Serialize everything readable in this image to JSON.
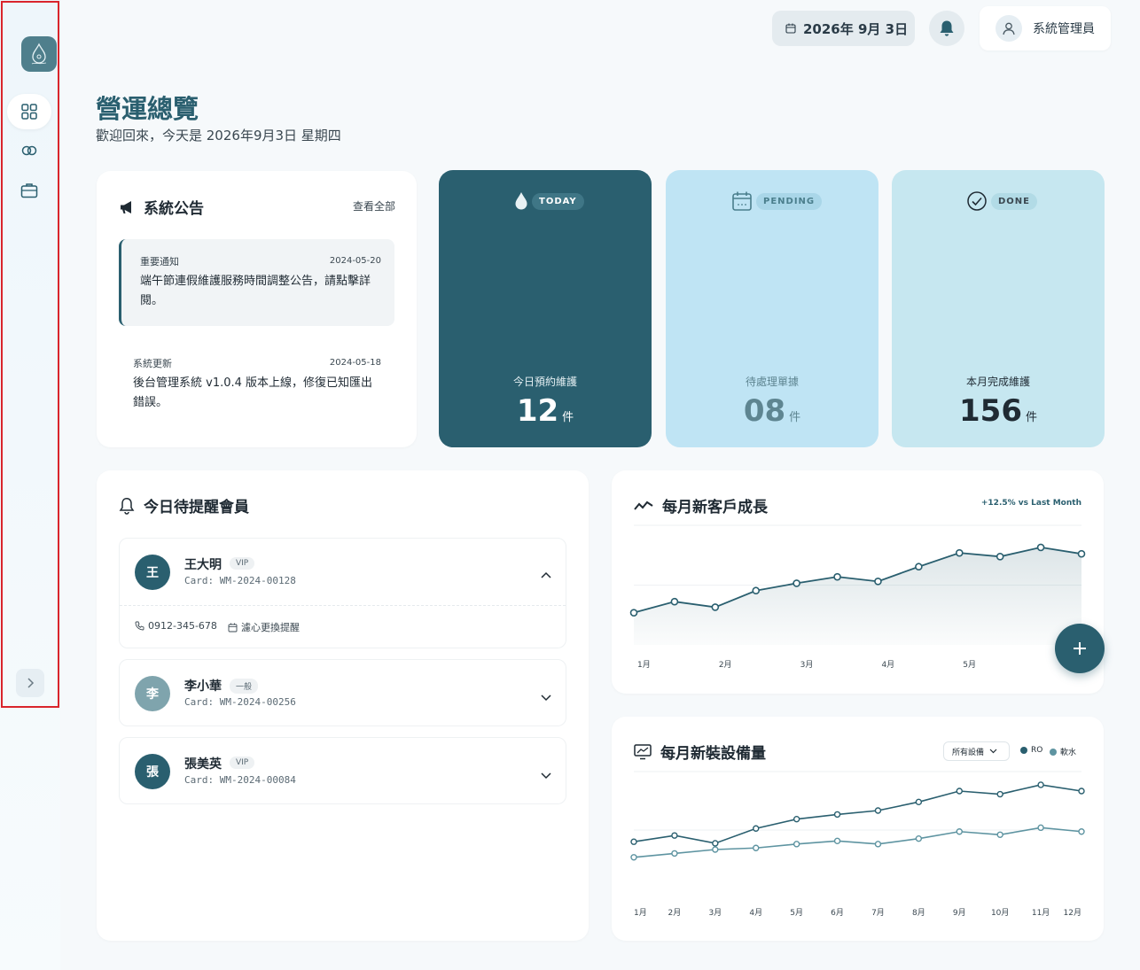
{
  "header": {
    "date": "2026年 9月 3日",
    "user": "系統管理員"
  },
  "page": {
    "title": "營運總覽",
    "subtitle": "歡迎回來，今天是 2026年9月3日 星期四"
  },
  "announcements": {
    "title": "系統公告",
    "view_all": "查看全部",
    "items": [
      {
        "tag": "重要通知",
        "date": "2024-05-20",
        "text": "端午節連假維護服務時間調整公告，請點擊詳閱。"
      },
      {
        "tag": "系統更新",
        "date": "2024-05-18",
        "text": "後台管理系統 v1.0.4 版本上線，修復已知匯出錯誤。"
      }
    ]
  },
  "stats": [
    {
      "badge": "TODAY",
      "label": "今日預約維護",
      "value": "12",
      "unit": "件",
      "icon": "water-drop-icon",
      "bg": "#2a5f6f"
    },
    {
      "badge": "PENDING",
      "label": "待處理單據",
      "value": "08",
      "unit": "件",
      "icon": "calendar-icon",
      "bg": "#bfe4f4"
    },
    {
      "badge": "DONE",
      "label": "本月完成維護",
      "value": "156",
      "unit": "件",
      "icon": "check-circle-icon",
      "bg": "#c6e7f0"
    }
  ],
  "reminders": {
    "title": "今日待提醒會員",
    "members": [
      {
        "initial": "王",
        "name": "王大明",
        "badge": "VIP",
        "card": "Card: WM-2024-00128",
        "phone": "0912-345-678",
        "note": "濾心更換提醒",
        "expanded": true,
        "avatar_color": "#2a5f6f"
      },
      {
        "initial": "李",
        "name": "李小華",
        "badge": "一般",
        "card": "Card: WM-2024-00256",
        "expanded": false,
        "avatar_color": "#7fa4ad"
      },
      {
        "initial": "張",
        "name": "張美英",
        "badge": "VIP",
        "card": "Card: WM-2024-00084",
        "expanded": false,
        "avatar_color": "#2a5f6f"
      }
    ]
  },
  "growth": {
    "title": "每月新客戶成長",
    "delta": "+12.5% vs Last Month"
  },
  "installs": {
    "title": "每月新裝設備量",
    "filter": "所有設備"
  },
  "chart_data": [
    {
      "type": "area",
      "title": "每月新客戶成長",
      "categories": [
        "1月",
        "2月",
        "3月",
        "4月",
        "5月"
      ],
      "series": [
        {
          "values": [
            35,
            47,
            41,
            59,
            67,
            74,
            69,
            85,
            100,
            96,
            106,
            99
          ]
        }
      ],
      "ylim": [
        0,
        130
      ],
      "grid": true,
      "color": "#2a5f6f"
    },
    {
      "type": "line",
      "title": "每月新裝設備量",
      "categories": [
        "1月",
        "2月",
        "3月",
        "4月",
        "5月",
        "6月",
        "7月",
        "8月",
        "9月",
        "10月",
        "11月",
        "12月"
      ],
      "series": [
        {
          "name": "RO",
          "values": [
            60,
            68,
            58,
            77,
            89,
            95,
            100,
            111,
            125,
            121,
            133,
            125
          ],
          "color": "#2a5f6f"
        },
        {
          "name": "軟水",
          "values": [
            40,
            45,
            50,
            52,
            57,
            61,
            57,
            64,
            73,
            69,
            78,
            73
          ],
          "color": "#5e94a1"
        }
      ],
      "ylim": [
        0,
        150
      ],
      "grid": true,
      "legend": "top-right"
    }
  ]
}
